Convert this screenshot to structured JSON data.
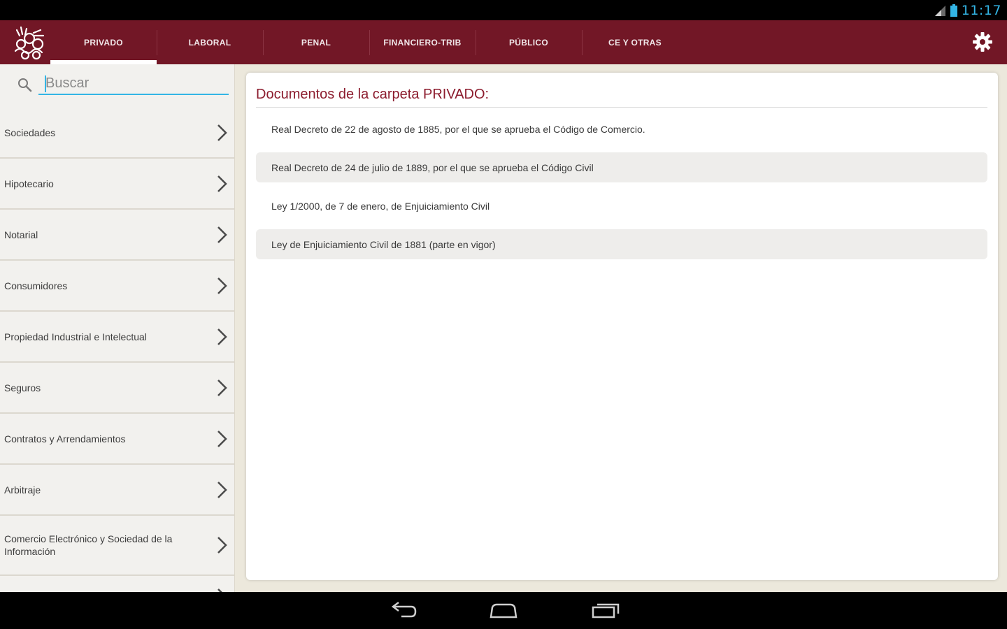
{
  "status_bar": {
    "time": "11:17",
    "icons": [
      "signal-icon",
      "battery-icon"
    ]
  },
  "app_bar": {
    "logo": "app-logo",
    "tabs": [
      {
        "label": "PRIVADO",
        "active": true
      },
      {
        "label": "LABORAL",
        "active": false
      },
      {
        "label": "PENAL",
        "active": false
      },
      {
        "label": "FINANCIERO-TRIB",
        "active": false
      },
      {
        "label": "PÚBLICO",
        "active": false
      },
      {
        "label": "CE Y OTRAS",
        "active": false
      }
    ],
    "settings_icon": "gear-icon"
  },
  "sidebar": {
    "search": {
      "placeholder": "Buscar",
      "value": ""
    },
    "categories": [
      {
        "label": "Sociedades"
      },
      {
        "label": "Hipotecario"
      },
      {
        "label": "Notarial"
      },
      {
        "label": "Consumidores"
      },
      {
        "label": "Propiedad Industrial e Intelectual"
      },
      {
        "label": "Seguros"
      },
      {
        "label": "Contratos y Arrendamientos"
      },
      {
        "label": "Arbitraje"
      },
      {
        "label": "Comercio Electrónico y Sociedad de la Información"
      }
    ]
  },
  "main": {
    "title": "Documentos de la carpeta PRIVADO:",
    "documents": [
      {
        "label": "Real Decreto de 22 de agosto de 1885, por el que se aprueba el Código de Comercio."
      },
      {
        "label": "Real Decreto de 24 de julio de 1889, por el que se aprueba el Código Civil"
      },
      {
        "label": "Ley 1/2000, de 7 de enero, de Enjuiciamiento Civil"
      },
      {
        "label": "Ley de Enjuiciamiento Civil de 1881 (parte en vigor)"
      }
    ]
  },
  "colors": {
    "app_bar": "#721726",
    "title": "#8c1c2e",
    "accent": "#33b5e5"
  }
}
